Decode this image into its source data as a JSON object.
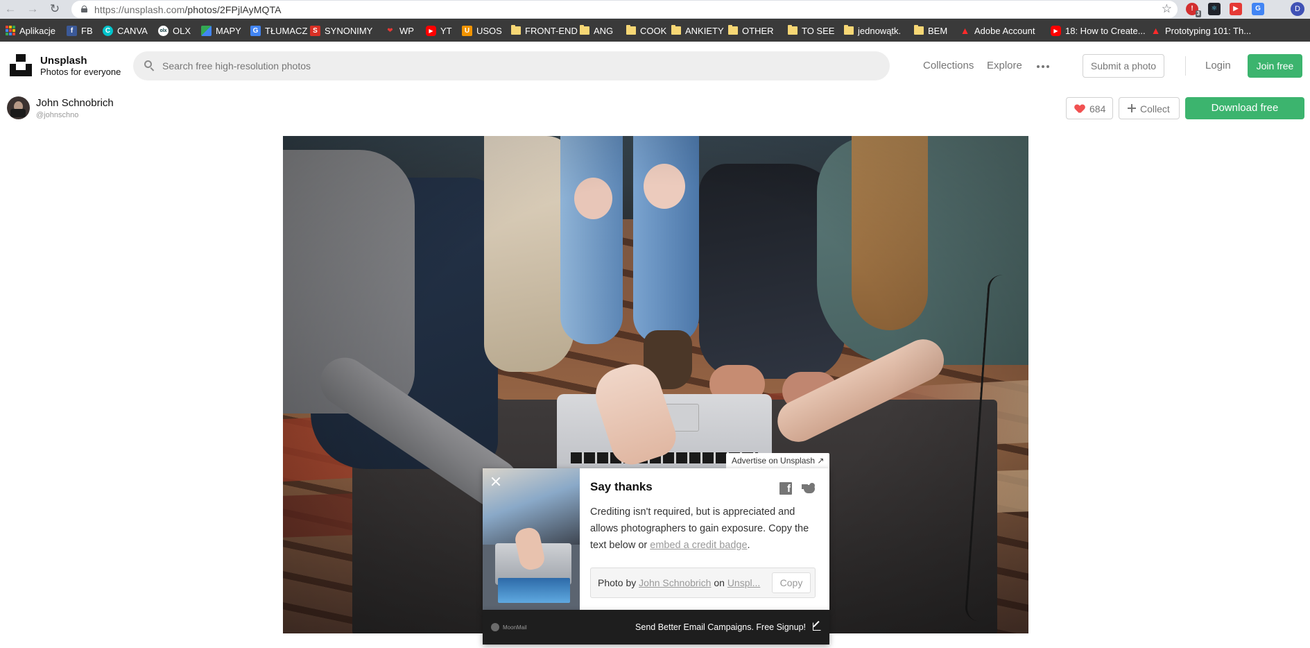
{
  "browser": {
    "url_host": "https://unsplash.com",
    "url_path": "/photos/2FPjlAyMQTA",
    "extension_badge": "3",
    "profile_initial": "D"
  },
  "bookmarks": [
    {
      "label": "Aplikacje",
      "icon": "apps-grid-icon"
    },
    {
      "label": "FB",
      "icon": "facebook-icon",
      "color": "#3b5998"
    },
    {
      "label": "CANVA",
      "icon": "canva-icon",
      "color": "#00c4cc"
    },
    {
      "label": "OLX",
      "icon": "olx-icon",
      "color": "#ffffff"
    },
    {
      "label": "MAPY",
      "icon": "maps-icon",
      "color": "#34a853"
    },
    {
      "label": "TŁUMACZ",
      "icon": "translate-icon",
      "color": "#4285f4"
    },
    {
      "label": "SYNONIMY",
      "icon": "synonimy-icon",
      "color": "#d93025"
    },
    {
      "label": "WP",
      "icon": "wp-icon",
      "color": "#d93025"
    },
    {
      "label": "YT",
      "icon": "youtube-icon",
      "color": "#ff0000"
    },
    {
      "label": "USOS",
      "icon": "usos-icon",
      "color": "#f29400"
    },
    {
      "label": "FRONT-END",
      "icon": "folder-icon"
    },
    {
      "label": "ANG",
      "icon": "folder-icon"
    },
    {
      "label": "COOK",
      "icon": "folder-icon"
    },
    {
      "label": "ANKIETY",
      "icon": "folder-icon"
    },
    {
      "label": "OTHER",
      "icon": "folder-icon"
    },
    {
      "label": "TO SEE",
      "icon": "folder-icon"
    },
    {
      "label": "jednowątk.",
      "icon": "folder-icon"
    },
    {
      "label": "BEM",
      "icon": "folder-icon"
    },
    {
      "label": "Adobe Account",
      "icon": "adobe-icon",
      "color": "#ff0000"
    },
    {
      "label": "18: How to Create...",
      "icon": "youtube-icon",
      "color": "#ff0000"
    },
    {
      "label": "Prototyping 101: Th...",
      "icon": "adobe-icon",
      "color": "#ff0000"
    }
  ],
  "header": {
    "brand_name": "Unsplash",
    "brand_tagline": "Photos for everyone",
    "search_placeholder": "Search free high-resolution photos",
    "nav_collections": "Collections",
    "nav_explore": "Explore",
    "submit_label": "Submit a photo",
    "login_label": "Login",
    "join_label": "Join free",
    "accent": "#3cb46e"
  },
  "photo_bar": {
    "author_name": "John Schnobrich",
    "author_handle": "@johnschno",
    "like_count": "684",
    "collect_label": "Collect",
    "download_label": "Download free"
  },
  "popup": {
    "advertise_label": "Advertise on Unsplash ↗",
    "title": "Say thanks",
    "text_before": "Crediting isn't required, but is appreciated and allows photographers to gain exposure. Copy the text below or ",
    "text_link": "embed a credit badge",
    "text_after": ".",
    "credit_prefix": "Photo by ",
    "credit_author": "John Schnobrich",
    "credit_mid": " on ",
    "credit_site": "Unspl...",
    "copy_label": "Copy"
  },
  "ad": {
    "brand": "MoonMail",
    "text": "Send Better Email Campaigns. Free Signup!"
  }
}
